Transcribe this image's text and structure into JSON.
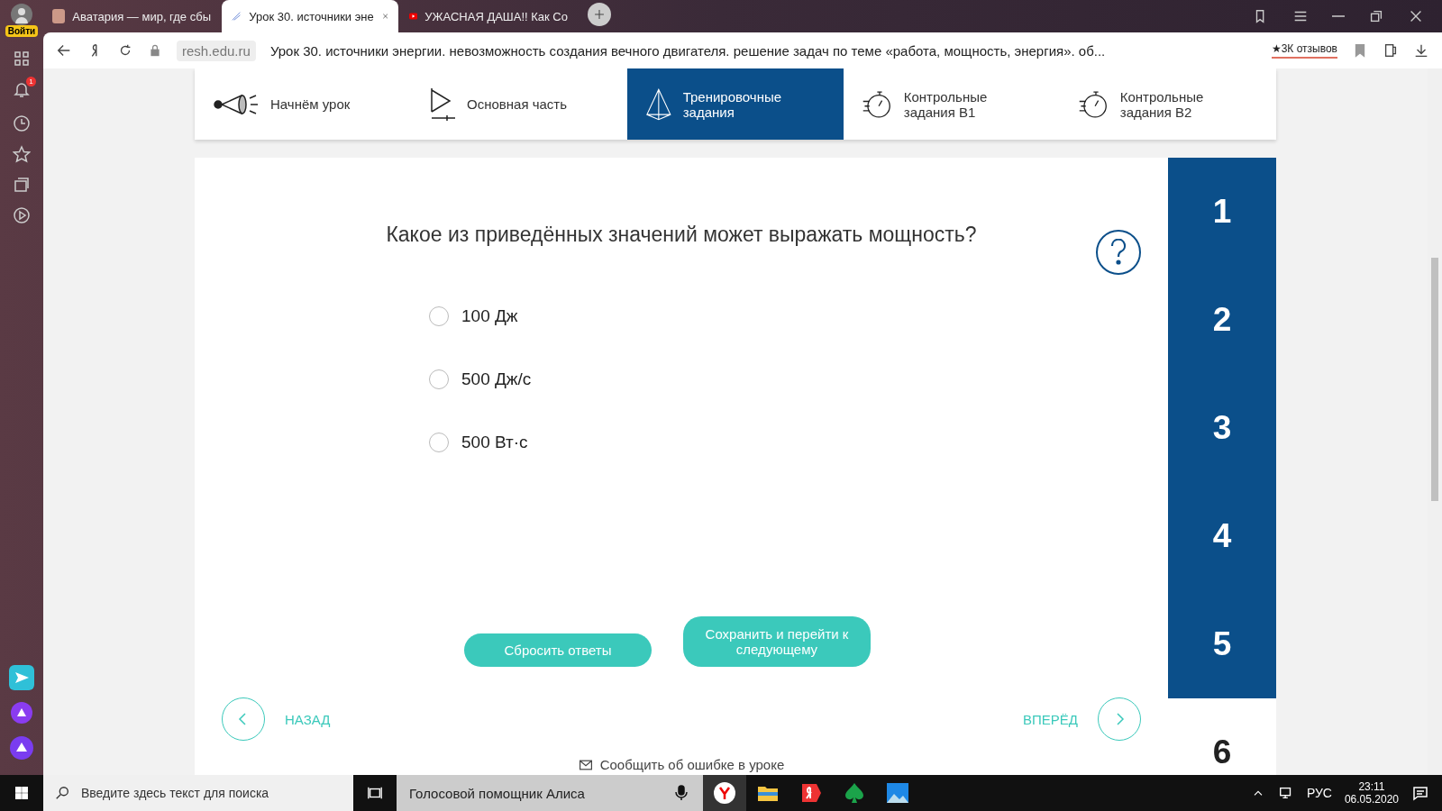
{
  "browser": {
    "profile_label": "Войти",
    "tabs": [
      {
        "title": "Аватария — мир, где сбы",
        "selected": false,
        "kind": "avatar"
      },
      {
        "title": "Урок 30. источники эне",
        "selected": true,
        "kind": "resh"
      },
      {
        "title": "УЖАСНАЯ ДАША!! Как Со",
        "selected": false,
        "kind": "video"
      }
    ],
    "domain": "resh.edu.ru",
    "page_title": "Урок 30. источники энергии. невозможность создания вечного двигателя. решение задач по теме «работа, мощность, энергия». об...",
    "reviews": "★3К отзывов",
    "notification_count": "1"
  },
  "lesson_nav": [
    {
      "label": "Начнём урок",
      "kind": "start",
      "selected": false
    },
    {
      "label": "Основная часть",
      "kind": "main",
      "selected": false
    },
    {
      "label": "Тренировочные задания",
      "kind": "training",
      "selected": true
    },
    {
      "label": "Контрольные задания В1",
      "kind": "control",
      "selected": false
    },
    {
      "label": "Контрольные задания В2",
      "kind": "control",
      "selected": false
    }
  ],
  "question": "Какое из приведённых значений может выражать мощность?",
  "options": [
    {
      "label": "100 Дж",
      "selected": false
    },
    {
      "label": "500 Дж/с",
      "selected": false
    },
    {
      "label": "500 Вт·с",
      "selected": false
    }
  ],
  "buttons": {
    "reset": "Сбросить ответы",
    "save": "Сохранить и перейти к следующему"
  },
  "back": "НАЗАД",
  "forward": "ВПЕРЁД",
  "report": "Сообщить об ошибке в уроке",
  "task_numbers": [
    {
      "label": "1",
      "kind": "current"
    },
    {
      "label": "2",
      "kind": "current"
    },
    {
      "label": "3",
      "kind": "current"
    },
    {
      "label": "4",
      "kind": "current"
    },
    {
      "label": "5",
      "kind": "current"
    },
    {
      "label": "6",
      "kind": "other"
    }
  ],
  "taskbar": {
    "search_placeholder": "Введите здесь текст для поиска",
    "assistant": "Голосовой помощник Алиса",
    "language": "РУС",
    "time": "23:11",
    "date": "06.05.2020"
  }
}
